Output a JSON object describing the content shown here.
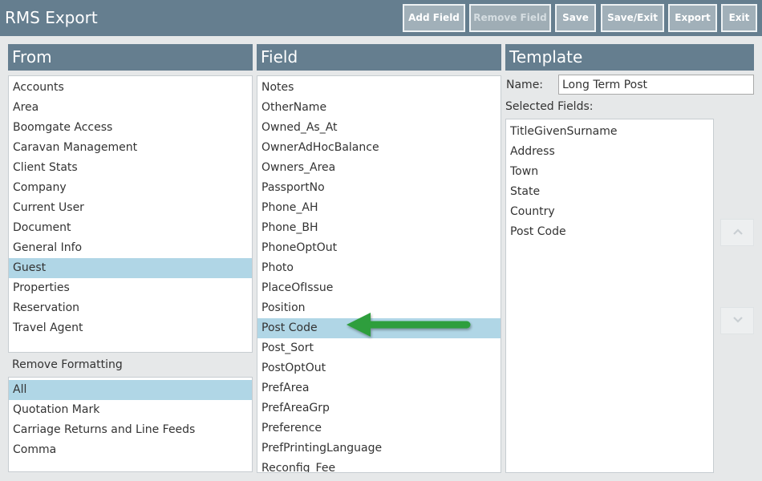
{
  "app": {
    "title": "RMS Export"
  },
  "toolbar": {
    "add_field": "Add Field",
    "remove_field": "Remove Field",
    "save": "Save",
    "save_exit": "Save/Exit",
    "export": "Export",
    "exit": "Exit"
  },
  "from": {
    "title": "From",
    "items": [
      "Accounts",
      "Area",
      "Boomgate Access",
      "Caravan Management",
      "Client Stats",
      "Company",
      "Current User",
      "Document",
      "General Info",
      "Guest",
      "Properties",
      "Reservation",
      "Travel Agent"
    ],
    "selected": "Guest"
  },
  "formatting": {
    "label": "Remove Formatting",
    "items": [
      "All",
      "Quotation Mark",
      "Carriage Returns and Line Feeds",
      "Comma"
    ],
    "selected": "All"
  },
  "field": {
    "title": "Field",
    "items": [
      "Notes",
      "OtherName",
      "Owned_As_At",
      "OwnerAdHocBalance",
      "Owners_Area",
      "PassportNo",
      "Phone_AH",
      "Phone_BH",
      "PhoneOptOut",
      "Photo",
      "PlaceOfIssue",
      "Position",
      "Post Code",
      "Post_Sort",
      "PostOptOut",
      "PrefArea",
      "PrefAreaGrp",
      "Preference",
      "PrefPrintingLanguage",
      "Reconfig_Fee"
    ],
    "selected": "Post Code"
  },
  "template": {
    "title": "Template",
    "name_label": "Name:",
    "name_value": "Long Term Post",
    "selected_fields_label": "Selected Fields:",
    "selected_fields": [
      "TitleGivenSurname",
      "Address",
      "Town",
      "State",
      "Country",
      "Post Code"
    ]
  },
  "colors": {
    "header_bg": "#657e8f",
    "button_bg": "#a1b0b9",
    "selected_row": "#b0d6e6",
    "annotation_arrow": "#2e9e3c"
  },
  "icons": {
    "move_up": "chevron-up-icon",
    "move_down": "chevron-down-icon",
    "annotation": "green-arrow-icon"
  }
}
